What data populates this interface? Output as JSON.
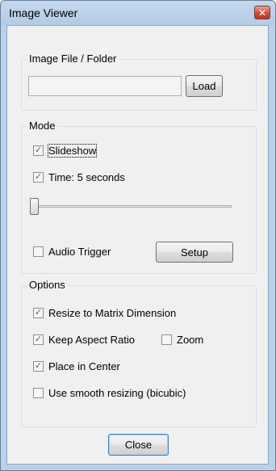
{
  "window": {
    "title": "Image Viewer",
    "close_glyph": "✕",
    "close_icon": "close-icon"
  },
  "image_group": {
    "label": "Image File / Folder",
    "path_value": "",
    "load_label": "Load"
  },
  "mode_group": {
    "label": "Mode",
    "slideshow": {
      "label": "Slideshow",
      "checked": true
    },
    "time": {
      "label": "Time: 5 seconds",
      "checked": true
    },
    "slider_position": 0.0,
    "audio_trigger": {
      "label": "Audio Trigger",
      "checked": false
    },
    "setup_label": "Setup"
  },
  "options_group": {
    "label": "Options",
    "resize": {
      "label": "Resize to Matrix Dimension",
      "checked": true
    },
    "keep_aspect": {
      "label": "Keep Aspect Ratio",
      "checked": true
    },
    "zoom": {
      "label": "Zoom",
      "checked": false
    },
    "center": {
      "label": "Place in Center",
      "checked": true
    },
    "smooth": {
      "label": "Use smooth resizing (bicubic)",
      "checked": false
    }
  },
  "footer": {
    "close_label": "Close"
  },
  "check_glyph": "✓"
}
